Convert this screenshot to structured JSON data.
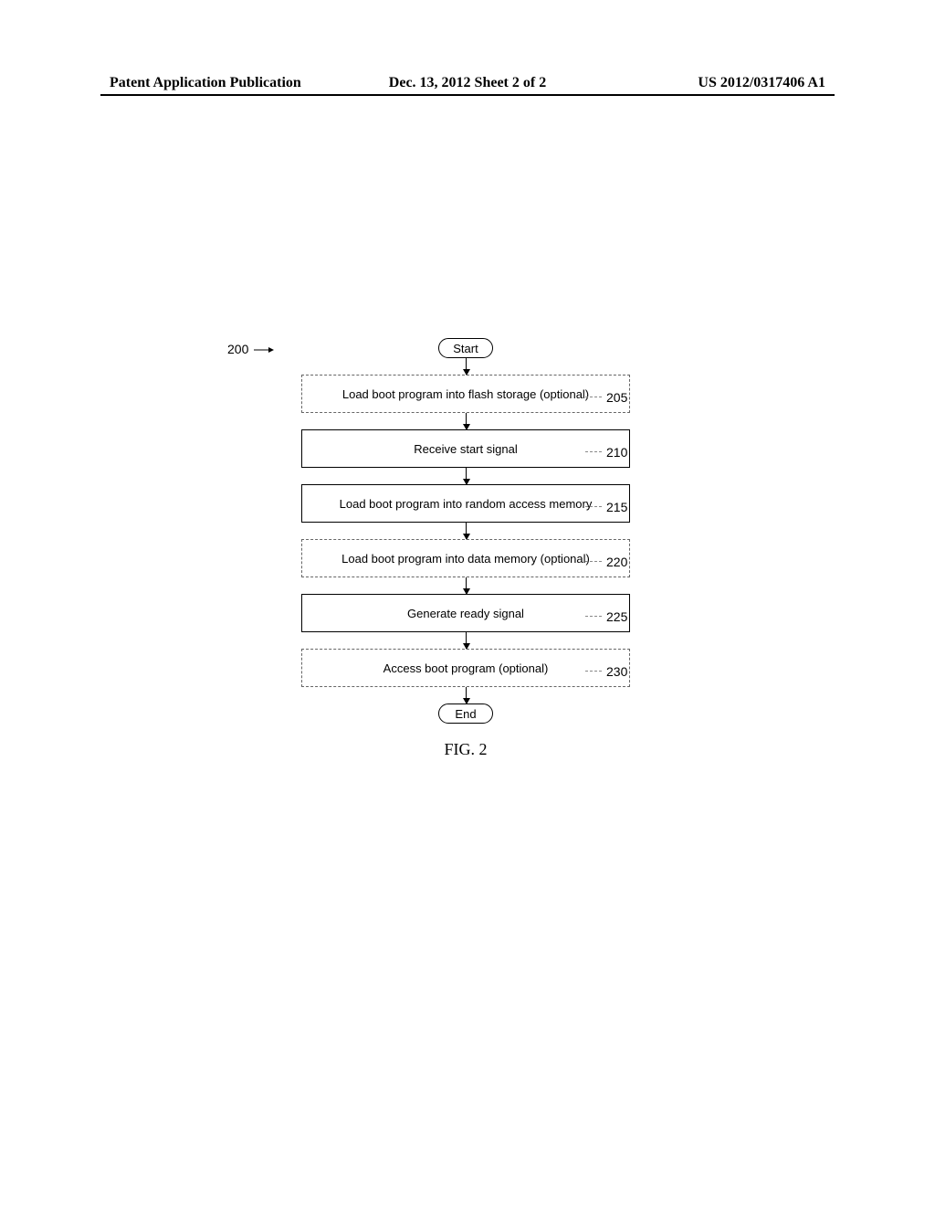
{
  "header": {
    "left": "Patent Application Publication",
    "center": "Dec. 13, 2012  Sheet 2 of 2",
    "right": "US 2012/0317406 A1"
  },
  "diagram": {
    "ref_main": "200",
    "start_label": "Start",
    "end_label": "End",
    "steps": [
      {
        "text": "Load boot program into flash storage (optional)",
        "ref": "205",
        "optional": true
      },
      {
        "text": "Receive start signal",
        "ref": "210",
        "optional": false
      },
      {
        "text": "Load boot program into random access memory",
        "ref": "215",
        "optional": false
      },
      {
        "text": "Load boot program into data memory (optional)",
        "ref": "220",
        "optional": true
      },
      {
        "text": "Generate ready signal",
        "ref": "225",
        "optional": false
      },
      {
        "text": "Access boot program (optional)",
        "ref": "230",
        "optional": true
      }
    ],
    "figure_label": "FIG. 2"
  }
}
